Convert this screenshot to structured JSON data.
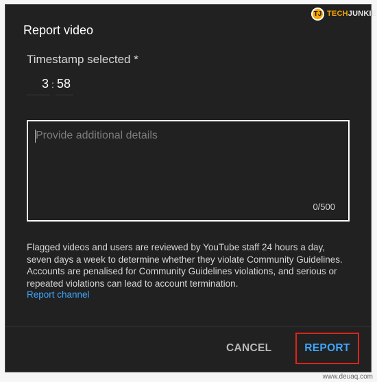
{
  "brand": {
    "logo_letters": "TJ",
    "name_prefix": "TECH",
    "name_suffix": "JUNKIE"
  },
  "dialog": {
    "title": "Report video",
    "timestamp": {
      "label": "Timestamp selected *",
      "minutes": "3",
      "separator": ":",
      "seconds": "58"
    },
    "details": {
      "placeholder": "Provide additional details",
      "counter": "0/500"
    },
    "info_text": "Flagged videos and users are reviewed by YouTube staff 24 hours a day, seven days a week to determine whether they violate Community Guidelines. Accounts are penalised for Community Guidelines violations, and serious or repeated violations can lead to account termination.",
    "report_channel_link": "Report channel",
    "buttons": {
      "cancel": "CANCEL",
      "report": "REPORT"
    }
  },
  "watermark": "www.deuaq.com",
  "colors": {
    "dialog_bg": "#212121",
    "link": "#3ea6ff",
    "highlight_border": "#e0231b",
    "brand_accent": "#f5a400"
  }
}
